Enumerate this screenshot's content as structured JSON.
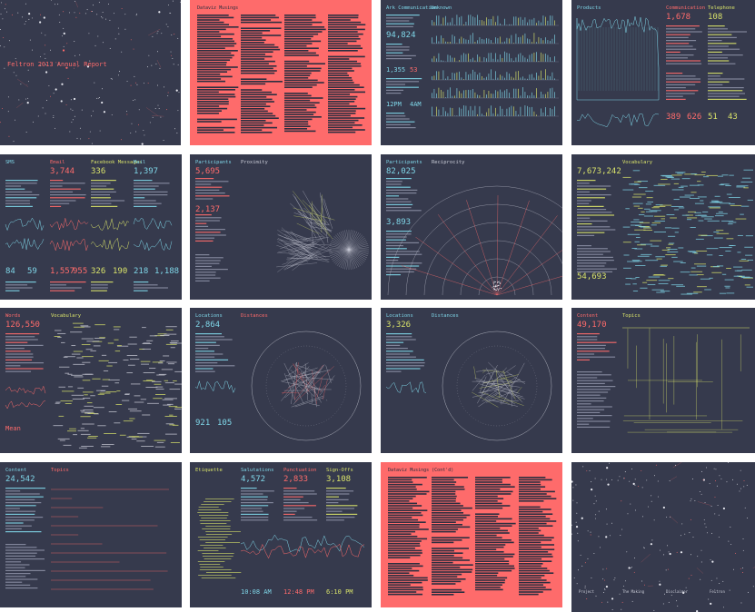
{
  "report": {
    "cover_title": "Feltron 2013 Annual Report",
    "essay_title": "Dataviz Musings",
    "essay_title_2": "Dataviz Musings (Cont'd)"
  },
  "pages": [
    {
      "titles": [
        "Ark Communication",
        "Unknown"
      ],
      "stats": [
        "94,824",
        "1,355",
        "53",
        "12PM",
        "4AM"
      ]
    },
    {
      "titles": [
        "Products",
        "Communication",
        "Telephone"
      ],
      "stats": [
        "1,678",
        "108",
        "389",
        "626",
        "51",
        "43"
      ]
    },
    {
      "titles": [
        "SMS",
        "Email",
        "Facebook Messages",
        "Mail"
      ],
      "stats": [
        "3,744",
        "336",
        "1,397",
        "84",
        "59",
        "1,557",
        "955",
        "326",
        "190",
        "218",
        "1,188"
      ]
    },
    {
      "titles": [
        "Participants",
        "Proximity"
      ],
      "stats": [
        "5,695",
        "2,137"
      ]
    },
    {
      "titles": [
        "Participants",
        "Reciprocity"
      ],
      "stats": [
        "82,025",
        "3,893"
      ]
    },
    {
      "titles": [
        "Words",
        "Vocabulary"
      ],
      "stats": [
        "7,673,242",
        "54,693"
      ]
    },
    {
      "titles": [
        "Words",
        "Vocabulary"
      ],
      "stats": [
        "126,550",
        "Mean"
      ]
    },
    {
      "titles": [
        "Locations",
        "Distances"
      ],
      "stats": [
        "2,864",
        "921",
        "105"
      ]
    },
    {
      "titles": [
        "Locations",
        "Distances"
      ],
      "stats": [
        "3,326"
      ]
    },
    {
      "titles": [
        "Content",
        "Topics"
      ],
      "stats": [
        "49,170"
      ]
    },
    {
      "titles": [
        "Content",
        "Topics"
      ],
      "stats": [
        "24,542"
      ]
    },
    {
      "titles": [
        "Etiquette",
        "Salutations",
        "Punctuation",
        "Sign-Offs"
      ],
      "stats": [
        "4,572",
        "2,833",
        "3,108",
        "10:08 AM",
        "12:48 PM",
        "6:10 PM"
      ]
    }
  ],
  "closing": {
    "labels": [
      "Project",
      "The Making",
      "Disclaimer"
    ],
    "footer": "Feltron"
  },
  "colors": {
    "page_bg": "#363a4d",
    "red_bg": "#fe6b6b",
    "cyan": "#7fd6e8",
    "pink": "#ff6b6b",
    "yellow": "#d9e36a"
  }
}
